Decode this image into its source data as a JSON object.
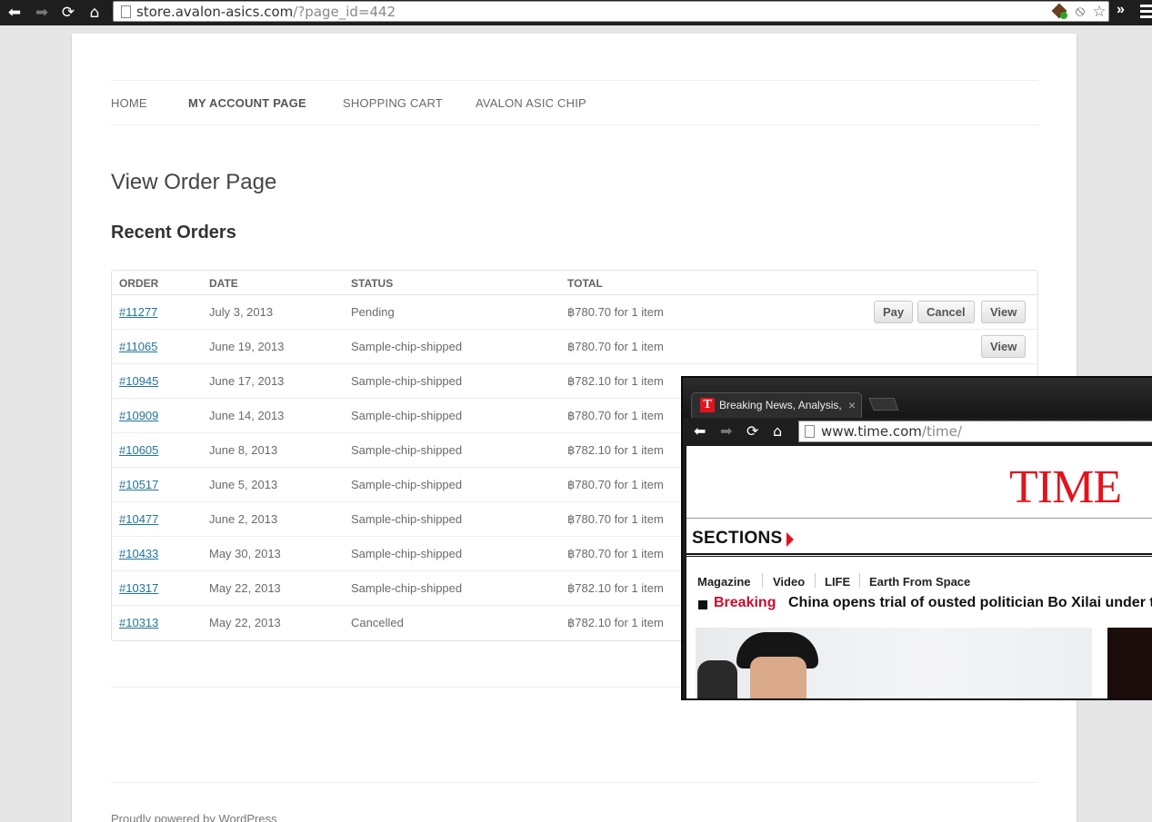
{
  "browser": {
    "url_host": "store.avalon-asics.com",
    "url_path": "/?page_id=442",
    "icons": [
      "back-icon",
      "forward-icon",
      "reload-icon",
      "home-icon",
      "page-icon",
      "avalon-extension-icon",
      "sync-extension-icon",
      "bookmark-star-icon",
      "more-extensions-icon",
      "chrome-menu-icon"
    ]
  },
  "nav": {
    "items": [
      {
        "label": "HOME"
      },
      {
        "label": "MY ACCOUNT PAGE"
      },
      {
        "label": "SHOPPING CART"
      },
      {
        "label": "AVALON ASIC CHIP"
      }
    ]
  },
  "main": {
    "page_title": "View Order Page",
    "section_title": "Recent Orders",
    "columns": [
      "ORDER",
      "DATE",
      "STATUS",
      "TOTAL"
    ],
    "orders": [
      {
        "order": "#11277",
        "date": "July 3, 2013",
        "status": "Pending",
        "total": "฿780.70 for 1 item",
        "actions": [
          "Pay",
          "Cancel",
          "View"
        ]
      },
      {
        "order": "#11065",
        "date": "June 19, 2013",
        "status": "Sample-chip-shipped",
        "total": "฿780.70 for 1 item",
        "actions": [
          "View"
        ]
      },
      {
        "order": "#10945",
        "date": "June 17, 2013",
        "status": "Sample-chip-shipped",
        "total": "฿782.10 for 1 item",
        "actions": []
      },
      {
        "order": "#10909",
        "date": "June 14, 2013",
        "status": "Sample-chip-shipped",
        "total": "฿780.70 for 1 item",
        "actions": []
      },
      {
        "order": "#10605",
        "date": "June 8, 2013",
        "status": "Sample-chip-shipped",
        "total": "฿782.10 for 1 item",
        "actions": []
      },
      {
        "order": "#10517",
        "date": "June 5, 2013",
        "status": "Sample-chip-shipped",
        "total": "฿780.70 for 1 item",
        "actions": []
      },
      {
        "order": "#10477",
        "date": "June 2, 2013",
        "status": "Sample-chip-shipped",
        "total": "฿780.70 for 1 item",
        "actions": []
      },
      {
        "order": "#10433",
        "date": "May 30, 2013",
        "status": "Sample-chip-shipped",
        "total": "฿780.70 for 1 item",
        "actions": []
      },
      {
        "order": "#10317",
        "date": "May 22, 2013",
        "status": "Sample-chip-shipped",
        "total": "฿782.10 for 1 item",
        "actions": []
      },
      {
        "order": "#10313",
        "date": "May 22, 2013",
        "status": "Cancelled",
        "total": "฿782.10 for 1 item",
        "actions": []
      }
    ]
  },
  "footer": {
    "text": "Proudly powered by WordPress"
  },
  "overlay": {
    "tab_title": "Breaking News, Analysis, P",
    "url_host": "www.time.com",
    "url_path": "/time/",
    "logo": "TIME",
    "sections_label": "SECTIONS",
    "links": [
      "Magazine",
      "Video",
      "LIFE",
      "Earth From Space"
    ],
    "breaking_label": "Breaking",
    "headline": "China opens trial of ousted politician Bo Xilai under ti",
    "brand_color": "#e1141e"
  }
}
